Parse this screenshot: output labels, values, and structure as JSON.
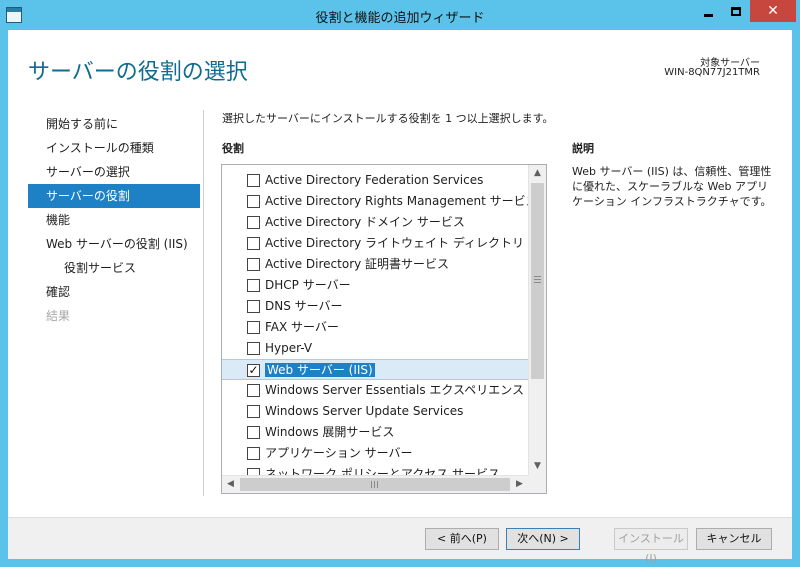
{
  "window": {
    "title": "役割と機能の追加ウィザード",
    "close_glyph": "✕"
  },
  "header": {
    "title": "サーバーの役割の選択",
    "target_label": "対象サーバー",
    "target_name": "WIN-8QN77J21TMR"
  },
  "nav": {
    "items": [
      {
        "label": "開始する前に",
        "state": "normal"
      },
      {
        "label": "インストールの種類",
        "state": "normal"
      },
      {
        "label": "サーバーの選択",
        "state": "normal"
      },
      {
        "label": "サーバーの役割",
        "state": "selected"
      },
      {
        "label": "機能",
        "state": "normal"
      },
      {
        "label": "Web サーバーの役割 (IIS)",
        "state": "normal"
      },
      {
        "label": "役割サービス",
        "state": "sub"
      },
      {
        "label": "確認",
        "state": "normal"
      },
      {
        "label": "結果",
        "state": "disabled"
      }
    ]
  },
  "main": {
    "instruction": "選択したサーバーにインストールする役割を 1 つ以上選択します。",
    "roles_header": "役割",
    "description_header": "説明",
    "description_text": "Web サーバー (IIS) は、信頼性、管理性に優れた、スケーラブルな Web アプリケーション インフラストラクチャです。",
    "roles": [
      {
        "label": "Active Directory Federation Services",
        "checked": false
      },
      {
        "label": "Active Directory Rights Management サービス",
        "checked": false
      },
      {
        "label": "Active Directory ドメイン サービス",
        "checked": false
      },
      {
        "label": "Active Directory ライトウェイト ディレクトリ サービス",
        "checked": false
      },
      {
        "label": "Active Directory 証明書サービス",
        "checked": false
      },
      {
        "label": "DHCP サーバー",
        "checked": false
      },
      {
        "label": "DNS サーバー",
        "checked": false
      },
      {
        "label": "FAX サーバー",
        "checked": false
      },
      {
        "label": "Hyper-V",
        "checked": false
      },
      {
        "label": "Web サーバー (IIS)",
        "checked": true,
        "selected": true
      },
      {
        "label": "Windows Server Essentials エクスペリエンス",
        "checked": false
      },
      {
        "label": "Windows Server Update Services",
        "checked": false
      },
      {
        "label": "Windows 展開サービス",
        "checked": false
      },
      {
        "label": "アプリケーション サーバー",
        "checked": false
      },
      {
        "label": "ネットワーク ポリシーとアクセス サービス",
        "checked": false
      }
    ],
    "check_glyph": "✓"
  },
  "footer": {
    "prev_label": "< 前へ(P)",
    "next_label": "次へ(N) >",
    "install_label": "インストール(I)",
    "cancel_label": "キャンセル"
  },
  "colors": {
    "title_bar": "#5bc3ea",
    "accent_selected": "#1e81c6",
    "close_button": "#c7463d",
    "page_title": "#0f6b8f"
  }
}
